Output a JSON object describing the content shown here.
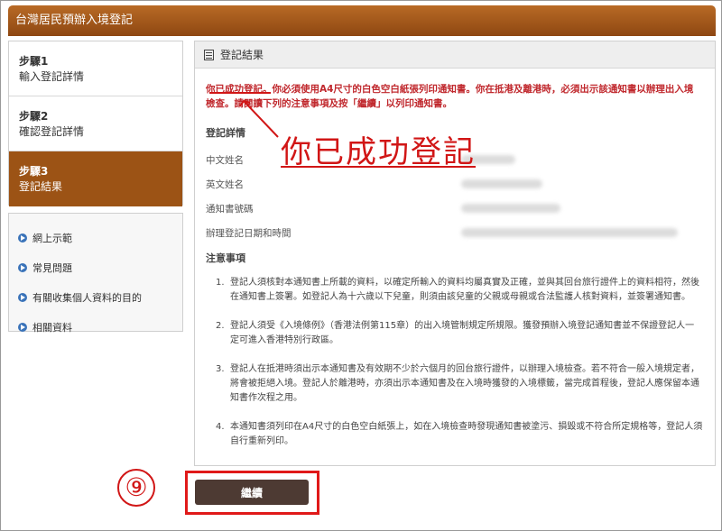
{
  "header": {
    "title": "台灣居民預辦入境登記"
  },
  "steps": [
    {
      "num": "步驟1",
      "label": "輸入登記詳情"
    },
    {
      "num": "步驟2",
      "label": "確認登記詳情"
    },
    {
      "num": "步驟3",
      "label": "登記結果"
    }
  ],
  "links": [
    {
      "label": "網上示範"
    },
    {
      "label": "常見問題"
    },
    {
      "label": "有關收集個人資料的目的"
    },
    {
      "label": "相關資料"
    }
  ],
  "panel": {
    "title": "登記結果",
    "notice": "你已成功登記。你必須使用A4尺寸的白色空白紙張列印通知書。你在抵港及離港時，必須出示該通知書以辦理出入境檢查。請閱讀下列的注意事項及按「繼續」以列印通知書。",
    "details_heading": "登記詳情",
    "fields": [
      "中文姓名",
      "英文姓名",
      "通知書號碼",
      "辦理登記日期和時間"
    ],
    "notes_heading": "注意事項",
    "notes": [
      {
        "n": "1.",
        "text": "登記人須核對本通知書上所載的資料，以確定所輸入的資料均屬真實及正確，並與其回台旅行證件上的資料相符，然後在通知書上簽署。如登記人為十六歲以下兒童，則須由該兒童的父親或母親或合法監護人核對資料，並簽署通知書。"
      },
      {
        "n": "2.",
        "text": "登記人須受《入境條例》（香港法例第115章）的出入境管制規定所規限。獲發預辦入境登記通知書並不保證登記人一定可進入香港特別行政區。"
      },
      {
        "n": "3.",
        "text": "登記人在抵港時須出示本通知書及有效期不少於六個月的回台旅行證件，以辦理入境檢查。若不符合一般入境規定者，將會被拒絕入境。登記人於離港時，亦須出示本通知書及在入境時獲發的入境標籤，當完成首程後，登記人應保留本通知書作次程之用。"
      },
      {
        "n": "4.",
        "text": "本通知書須列印在A4尺寸的白色空白紙張上，如在入境檢查時發現通知書被塗污、損毀或不符合所定規格等，登記人須自行重新列印。"
      }
    ]
  },
  "annotation": {
    "text": "你已成功登記",
    "step_number": "⑨"
  },
  "continue_button": {
    "label": "繼續"
  },
  "colors": {
    "header": "#9c5315",
    "active_step": "#9c5315",
    "notice": "#c0282d",
    "annotation": "#d11616",
    "button": "#4d3a33"
  }
}
